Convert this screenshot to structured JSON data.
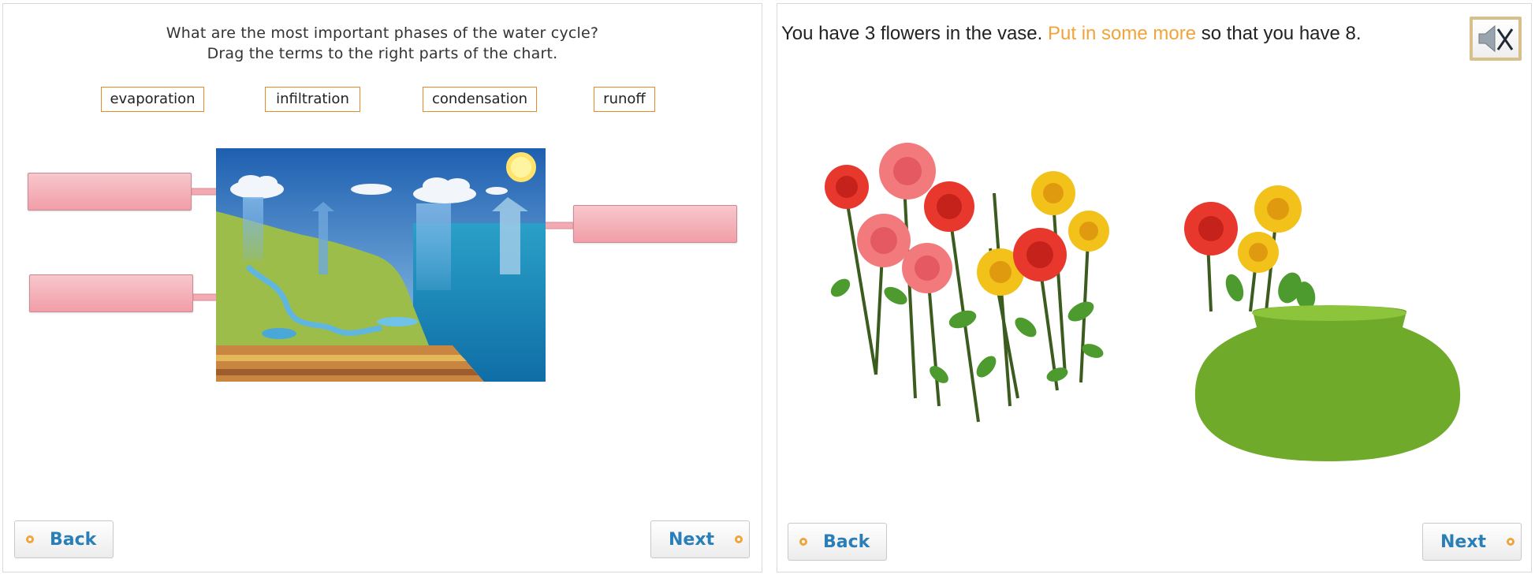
{
  "left": {
    "question_line1": "What are the most important phases of the water cycle?",
    "question_line2": "Drag the terms to the right parts of the chart.",
    "terms": [
      "evaporation",
      "infiltration",
      "condensation",
      "runoff"
    ],
    "back_label": "Back",
    "next_label": "Next"
  },
  "right": {
    "sentence_part1": "You have 3 flowers in the vase. ",
    "sentence_highlight": "Put in some more",
    "sentence_part2": " so that you have 8.",
    "back_label": "Back",
    "next_label": "Next"
  },
  "icons": {
    "sound": "speaker-muted-icon",
    "nav": "bullet-circle-icon"
  },
  "colors": {
    "accent_orange": "#f0a43a",
    "link_blue": "#2a7fb8",
    "dropzone_pink": "#f29ea8",
    "vase_green": "#6faa2a"
  }
}
